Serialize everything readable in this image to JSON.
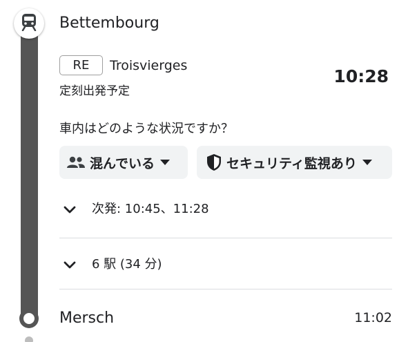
{
  "departure": {
    "station": "Bettembourg",
    "train_type": "RE",
    "destination": "Troisvierges",
    "status": "定刻出発予定",
    "time": "10:28"
  },
  "crowding": {
    "question": "車内はどのような状況ですか？",
    "chips": [
      {
        "label": "混んでいる",
        "icon": "people-icon"
      },
      {
        "label": "セキュリティ監視あり",
        "icon": "shield-icon"
      }
    ]
  },
  "next_departures": {
    "label": "次発: 10:45、11:28"
  },
  "stops": {
    "label": "6 駅 (34 分)"
  },
  "arrival": {
    "station": "Mersch",
    "time": "11:02"
  },
  "colors": {
    "track": "#555555",
    "chip_bg": "#f1f3f4",
    "divider": "#dadce0"
  }
}
